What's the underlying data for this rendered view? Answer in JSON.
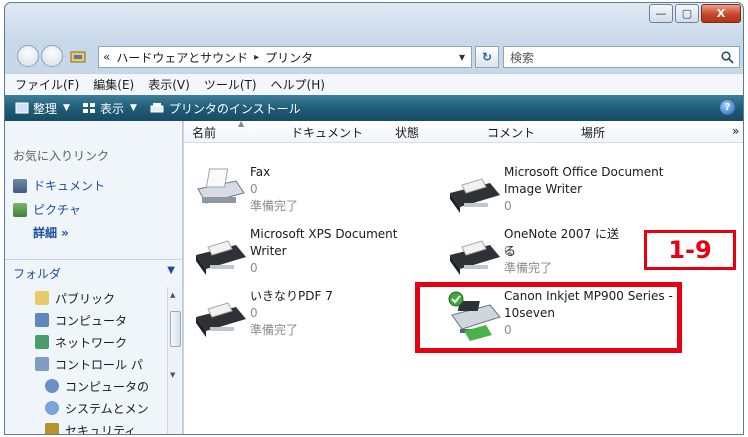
{
  "window": {
    "minimize": "—",
    "maximize": "▢",
    "close": "X"
  },
  "address": {
    "chevron": "«",
    "part1": "ハードウェアとサウンド",
    "sep": "▸",
    "part2": "プリンタ",
    "dropdown": "▾",
    "refresh": "↻"
  },
  "search": {
    "placeholder": "検索",
    "icon": "search-icon"
  },
  "menu": [
    "ファイル(F)",
    "編集(E)",
    "表示(V)",
    "ツール(T)",
    "ヘルプ(H)"
  ],
  "commands": {
    "organize": "整理",
    "view": "表示",
    "install": "プリンタのインストール",
    "help": "?"
  },
  "nav": {
    "favorites_header": "お気に入りリンク",
    "favorites": [
      "ドキュメント",
      "ピクチャ"
    ],
    "more": "詳細 »",
    "folders_header": "フォルダ",
    "folders": [
      "パブリック",
      "コンピュータ",
      "ネットワーク",
      "コントロール パ",
      "コンピュータの",
      "システムとメン",
      "セキュリティ"
    ]
  },
  "columns": [
    "名前",
    "ドキュメント",
    "状態",
    "コメント",
    "場所",
    "»"
  ],
  "printers": [
    {
      "name_lines": [
        "Fax"
      ],
      "count": "0",
      "status": "準備完了"
    },
    {
      "name_lines": [
        "Microsoft Office Document",
        "Image Writer"
      ],
      "count": "0",
      "status": ""
    },
    {
      "name_lines": [
        "Microsoft XPS Document",
        "Writer"
      ],
      "count": "0",
      "status": ""
    },
    {
      "name_lines": [
        "OneNote 2007 に送る"
      ],
      "count": "0",
      "status": "準備完了"
    },
    {
      "name_lines": [
        "いきなりPDF 7"
      ],
      "count": "0",
      "status": "準備完了"
    },
    {
      "name_lines": [
        "Canon Inkjet MP900 Series -",
        "10seven"
      ],
      "count": "0",
      "status": "",
      "default": true
    }
  ],
  "annotation": {
    "badge": "1-9"
  },
  "colors": {
    "highlight": "#e60012",
    "command_bar": "#1f5d79",
    "link": "#1a4fa0"
  }
}
